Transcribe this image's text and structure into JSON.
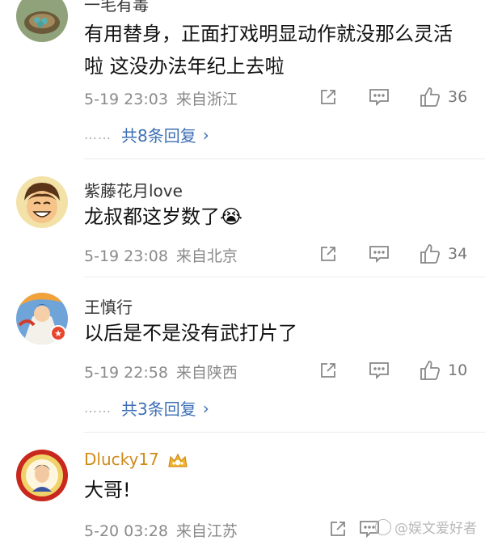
{
  "comments": [
    {
      "username": "一毛有毒",
      "text": "有用替身，正面打戏明显动作就没那么灵活啦  这没办法年纪上去啦",
      "date": "5-19 23:03",
      "location": "来自浙江",
      "likes": "36",
      "replies": "共8条回复",
      "avatar": "bird-nest-avatar"
    },
    {
      "username": "紫藤花月love",
      "text": "龙叔都这岁数了😭",
      "date": "5-19 23:08",
      "location": "来自北京",
      "likes": "34",
      "avatar": "cartoon-boy-avatar"
    },
    {
      "username": "王慎行",
      "text": "以后是不是没有武打片了",
      "date": "5-19 22:58",
      "location": "来自陕西",
      "likes": "10",
      "replies": "共3条回复",
      "avatar": "anime-character-avatar"
    },
    {
      "username": "Dlucky17",
      "text": "大哥!",
      "date": "5-20 03:28",
      "location": "来自江苏",
      "likes": "",
      "avatar": "portrait-avatar"
    }
  ],
  "watermark": "@娱文爱好者",
  "colors": {
    "link": "#3d6fb6",
    "meta": "#8a8a8a",
    "vip_name": "#d08a1a"
  }
}
